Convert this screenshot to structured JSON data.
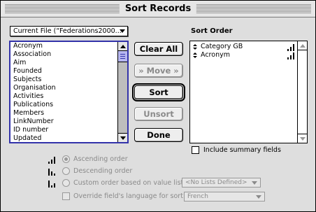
{
  "window": {
    "title": "Sort Records"
  },
  "file_popup": {
    "value": "Current File (“Federations2000..."
  },
  "fields": [
    "Acronym",
    "Association",
    "Aim",
    "Founded",
    "Subjects",
    "Organisation",
    "Activities",
    "Publications",
    "Members",
    "LinkNumber",
    "ID number",
    "Updated"
  ],
  "buttons": {
    "clear_all": "Clear All",
    "move": "» Move »",
    "sort": "Sort",
    "unsort": "Unsort",
    "done": "Done"
  },
  "sort_order": {
    "label": "Sort Order",
    "items": [
      "Category GB",
      "Acronym"
    ]
  },
  "include_summary": {
    "label": "Include summary fields",
    "checked": false
  },
  "order_options": {
    "ascending": "Ascending order",
    "descending": "Descending order",
    "custom": "Custom order based on value list",
    "selected": "ascending",
    "value_list": "<No Lists Defined>"
  },
  "override_language": {
    "label": "Override field's language for sort",
    "checked": false,
    "language": "French"
  },
  "colors": {
    "selection_border": "#3333aa",
    "thumb": "#b6b6f0",
    "disabled_text": "#8a8a8a"
  },
  "icons": [
    "chevron-down-icon",
    "scroll-up-arrow-icon",
    "scroll-down-arrow-icon",
    "sort-handle-icon",
    "ascending-order-icon",
    "descending-order-icon",
    "custom-order-icon"
  ]
}
